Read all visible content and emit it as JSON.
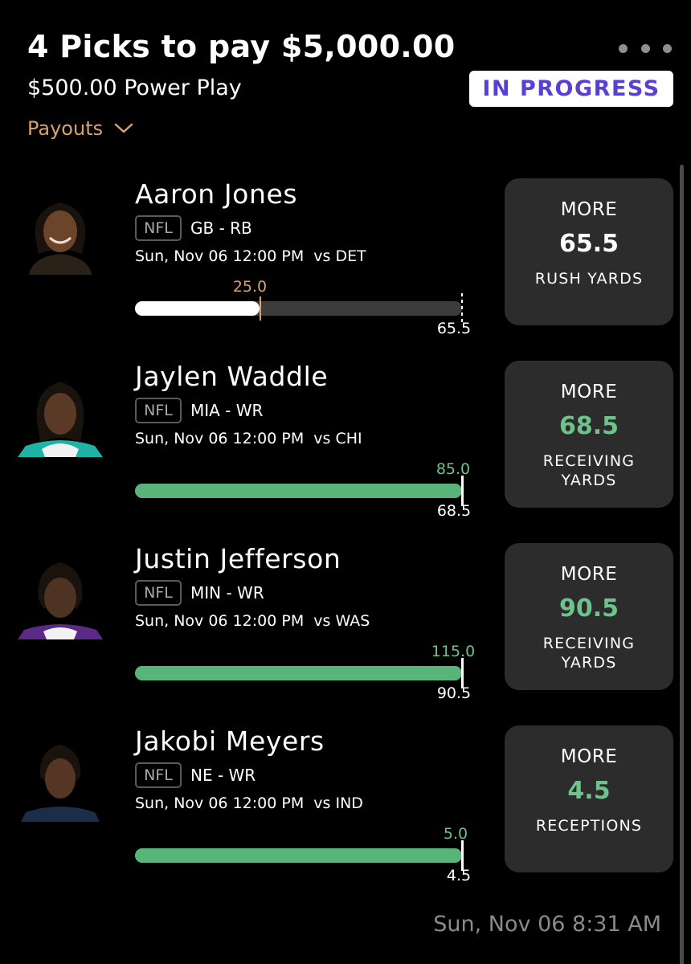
{
  "header": {
    "title": "4 Picks to pay $5,000.00",
    "subtitle": "$500.00 Power Play",
    "status": "IN PROGRESS",
    "payouts_label": "Payouts"
  },
  "colors": {
    "accent_purple": "#5a3fd6",
    "payouts_gold": "#d6a46a",
    "progress_green": "#58b57a",
    "card_bg": "#2c2c2c"
  },
  "picks": [
    {
      "name": "Aaron Jones",
      "league": "NFL",
      "team_pos": "GB - RB",
      "game": "Sun, Nov 06 12:00 PM  vs DET",
      "current": "25.0",
      "line": "65.5",
      "direction": "MORE",
      "stat": "RUSH YARDS",
      "progress_fraction": 0.382
    },
    {
      "name": "Jaylen Waddle",
      "league": "NFL",
      "team_pos": "MIA - WR",
      "game": "Sun, Nov 06 12:00 PM  vs CHI",
      "current": "85.0",
      "line": "68.5",
      "direction": "MORE",
      "stat": "RECEIVING YARDS",
      "progress_fraction": 1.0
    },
    {
      "name": "Justin Jefferson",
      "league": "NFL",
      "team_pos": "MIN - WR",
      "game": "Sun, Nov 06 12:00 PM  vs WAS",
      "current": "115.0",
      "line": "90.5",
      "direction": "MORE",
      "stat": "RECEIVING YARDS",
      "progress_fraction": 1.0
    },
    {
      "name": "Jakobi Meyers",
      "league": "NFL",
      "team_pos": "NE - WR",
      "game": "Sun, Nov 06 12:00 PM  vs IND",
      "current": "5.0",
      "line": "4.5",
      "direction": "MORE",
      "stat": "RECEPTIONS",
      "progress_fraction": 1.0
    }
  ],
  "footer": {
    "timestamp": "Sun, Nov 06 8:31 AM"
  }
}
